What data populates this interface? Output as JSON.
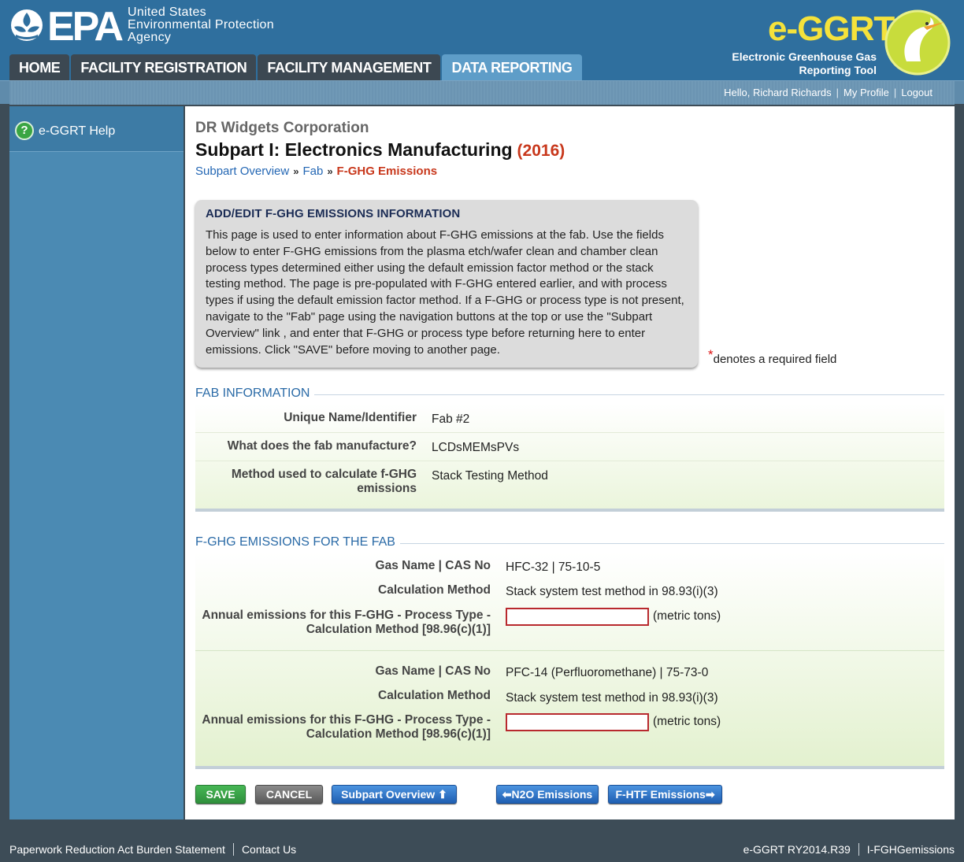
{
  "header": {
    "agency_abbr": "EPA",
    "agency_lines": [
      "United States",
      "Environmental Protection",
      "Agency"
    ],
    "tabs": [
      {
        "label": "HOME",
        "active": false
      },
      {
        "label": "FACILITY REGISTRATION",
        "active": false
      },
      {
        "label": "FACILITY MANAGEMENT",
        "active": false
      },
      {
        "label": "DATA REPORTING",
        "active": true
      }
    ],
    "brand": {
      "title": "e-GGRT",
      "sub_line1": "Electronic Greenhouse Gas",
      "sub_line2": "Reporting Tool"
    }
  },
  "userbar": {
    "greeting": "Hello, Richard Richards",
    "profile": "My Profile",
    "logout": "Logout"
  },
  "sidebar": {
    "help_label": "e-GGRT Help",
    "help_icon": "question-circle-icon"
  },
  "page": {
    "company": "DR Widgets Corporation",
    "title": "Subpart I: Electronics Manufacturing",
    "year": "(2016)",
    "breadcrumb": {
      "items": [
        "Subpart Overview",
        "Fab"
      ],
      "separator": "»",
      "current": "F-GHG Emissions"
    }
  },
  "info": {
    "heading": "ADD/EDIT F-GHG EMISSIONS INFORMATION",
    "text": "This page is used to enter information about F-GHG emissions at the fab. Use the fields below to enter F-GHG emissions from the plasma etch/wafer clean and chamber clean process types determined either using the default emission factor method or the stack testing method. The page is pre-populated with F-GHG entered earlier, and with process types if using the default emission factor method. If a F-GHG or process type is not present, navigate to the \"Fab\" page using the navigation buttons at the top or use the \"Subpart Overview\" link , and enter that F-GHG or process type before returning here to enter emissions. Click \"SAVE\" before moving to another page."
  },
  "required_note": {
    "star": "*",
    "text": "denotes a required field"
  },
  "fab": {
    "title": "FAB INFORMATION",
    "rows": [
      {
        "label": "Unique Name/Identifier",
        "value": "Fab #2"
      },
      {
        "label": "What does the fab manufacture?",
        "value": "LCDsMEMsPVs"
      },
      {
        "label_line1": "Method used to calculate f-GHG",
        "label_line2": "emissions",
        "value": "Stack Testing Method"
      }
    ]
  },
  "emissions": {
    "title": "F-GHG EMISSIONS FOR THE FAB",
    "labels": {
      "gas": "Gas Name | CAS No",
      "method": "Calculation Method",
      "annual_line1": "Annual emissions for this F-GHG - Process Type -",
      "annual_line2": "Calculation Method [98.96(c)(1)]"
    },
    "unit": "(metric tons)",
    "entries": [
      {
        "gas": "HFC-32 | 75-10-5",
        "method": "Stack system test method in 98.93(i)(3)",
        "value": ""
      },
      {
        "gas": "PFC-14 (Perfluoromethane) | 75-73-0",
        "method": "Stack system test method in 98.93(i)(3)",
        "value": ""
      }
    ]
  },
  "buttons": {
    "save": "SAVE",
    "cancel": "CANCEL",
    "overview": "Subpart Overview",
    "n2o": "N2O Emissions",
    "fhtf": "F-HTF Emissions"
  },
  "footer": {
    "paperwork": "Paperwork Reduction Act Burden Statement",
    "contact": "Contact Us",
    "version": "e-GGRT RY2014.R39",
    "page_id": "I-FGHGemissions"
  }
}
